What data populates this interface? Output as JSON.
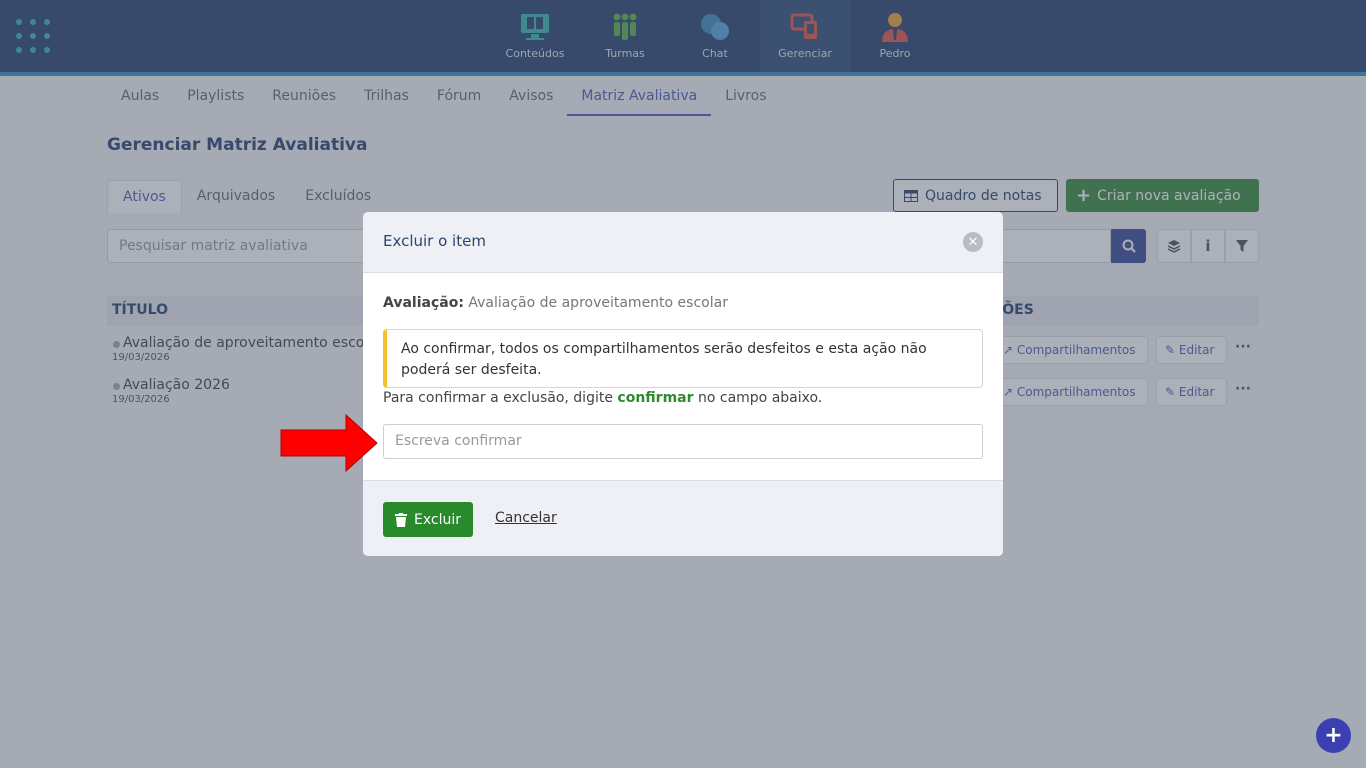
{
  "topnav": {
    "items": [
      {
        "label": "Conteúdos",
        "icon": "monitor-book-icon"
      },
      {
        "label": "Turmas",
        "icon": "people-group-icon"
      },
      {
        "label": "Chat",
        "icon": "chat-bubbles-icon"
      },
      {
        "label": "Gerenciar",
        "icon": "manage-devices-icon",
        "active": true
      },
      {
        "label": "Pedro",
        "icon": "user-avatar-icon"
      }
    ]
  },
  "subnav": {
    "items": [
      "Aulas",
      "Playlists",
      "Reuniões",
      "Trilhas",
      "Fórum",
      "Avisos",
      "Matriz Avaliativa",
      "Livros"
    ],
    "active": "Matriz Avaliativa"
  },
  "page": {
    "title": "Gerenciar Matriz Avaliativa",
    "status_tabs": [
      "Ativos",
      "Arquivados",
      "Excluídos"
    ],
    "grades_button": "Quadro de notas",
    "create_button": "Criar nova avaliação",
    "search_placeholder": "Pesquisar matriz avaliativa"
  },
  "table": {
    "headers": {
      "title": "TÍTULO",
      "actions": "ÇÕES"
    },
    "rows": [
      {
        "name": "Avaliação de aproveitamento esco",
        "date": "19/03/2026",
        "share": "Compartilhamentos",
        "edit": "Editar"
      },
      {
        "name": "Avaliação 2026",
        "date": "19/03/2026",
        "share": "Compartilhamentos",
        "edit": "Editar"
      }
    ]
  },
  "modal": {
    "title": "Excluir o item",
    "eval_label": "Avaliação:",
    "eval_value": "Avaliação de aproveitamento escolar",
    "warning": "Ao confirmar, todos os compartilhamentos serão desfeitos e esta ação não poderá ser desfeita.",
    "instr_before": "Para confirmar a exclusão, digite",
    "instr_keyword": "confirmar",
    "instr_after": "no campo abaixo.",
    "input_placeholder": "Escreva confirmar",
    "delete_button": "Excluir",
    "cancel_button": "Cancelar"
  },
  "colors": {
    "topbar": "#2b4571",
    "accent": "#5262b5",
    "create_green": "#3b8f3e",
    "delete_green": "#288a2c",
    "warning_yellow": "#f2c12e",
    "annotation_red": "#ff0000"
  }
}
